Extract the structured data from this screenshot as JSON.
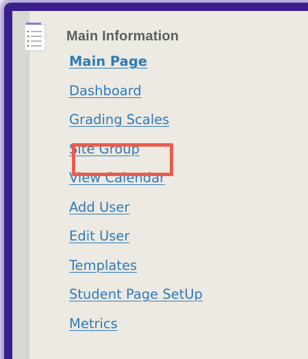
{
  "sidebar": {
    "section_title": "Main Information",
    "section_icon": "document-list-icon",
    "items": [
      {
        "label": "Main Page",
        "bold": true
      },
      {
        "label": "Dashboard"
      },
      {
        "label": "Grading Scales"
      },
      {
        "label": "Site Group",
        "highlighted": true
      },
      {
        "label": "View Calendar"
      },
      {
        "label": "Add User"
      },
      {
        "label": "Edit User"
      },
      {
        "label": "Templates"
      },
      {
        "label": "Student Page SetUp"
      },
      {
        "label": "Metrics"
      }
    ]
  },
  "colors": {
    "link": "#2f7bb8",
    "title": "#5e5e5e",
    "panel_bg": "#eceae3",
    "highlight": "#ee5a4c",
    "window_shadow": "#3a1f8a"
  }
}
